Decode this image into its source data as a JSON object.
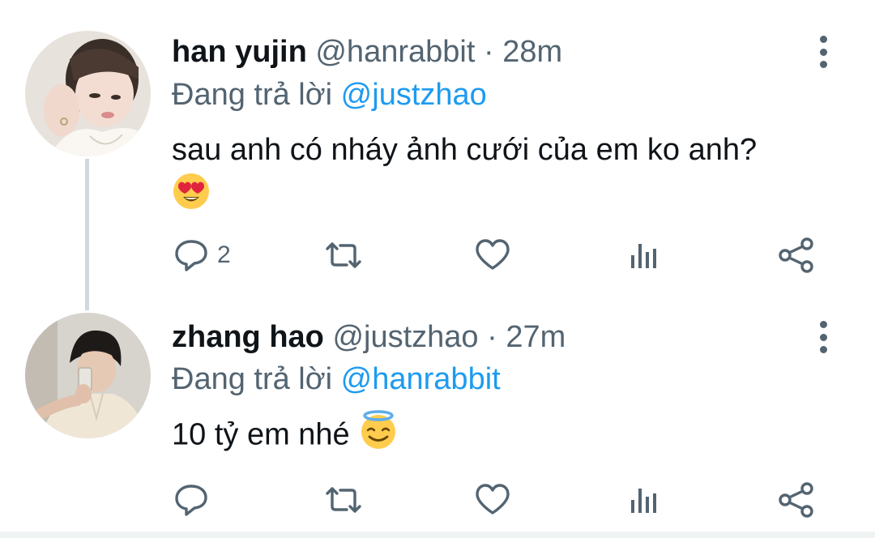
{
  "thread": [
    {
      "display_name": "han yujin",
      "handle": "@hanrabbit",
      "separator": "·",
      "time": "28m",
      "reply_prefix": "Đang trả lời",
      "reply_to": "@justzhao",
      "text": "sau anh có nháy ảnh cưới của em ko anh?",
      "emoji": "heart-eyes",
      "reply_count": "2",
      "avatar": "avatar-photo-light"
    },
    {
      "display_name": "zhang hao",
      "handle": "@justzhao",
      "separator": "·",
      "time": "27m",
      "reply_prefix": "Đang trả lời",
      "reply_to": "@hanrabbit",
      "text": "10 tỷ em nhé",
      "emoji": "halo-smile",
      "reply_count": "",
      "avatar": "avatar-photo-mirror-selfie"
    }
  ],
  "icons": {
    "reply": "reply-icon",
    "retweet": "retweet-icon",
    "like": "like-icon",
    "views": "views-icon",
    "share": "share-icon",
    "more": "more-options-icon"
  },
  "colors": {
    "text": "#0f1419",
    "secondary": "#536471",
    "link": "#1d9bf0",
    "thread_line": "#cfd9de"
  }
}
